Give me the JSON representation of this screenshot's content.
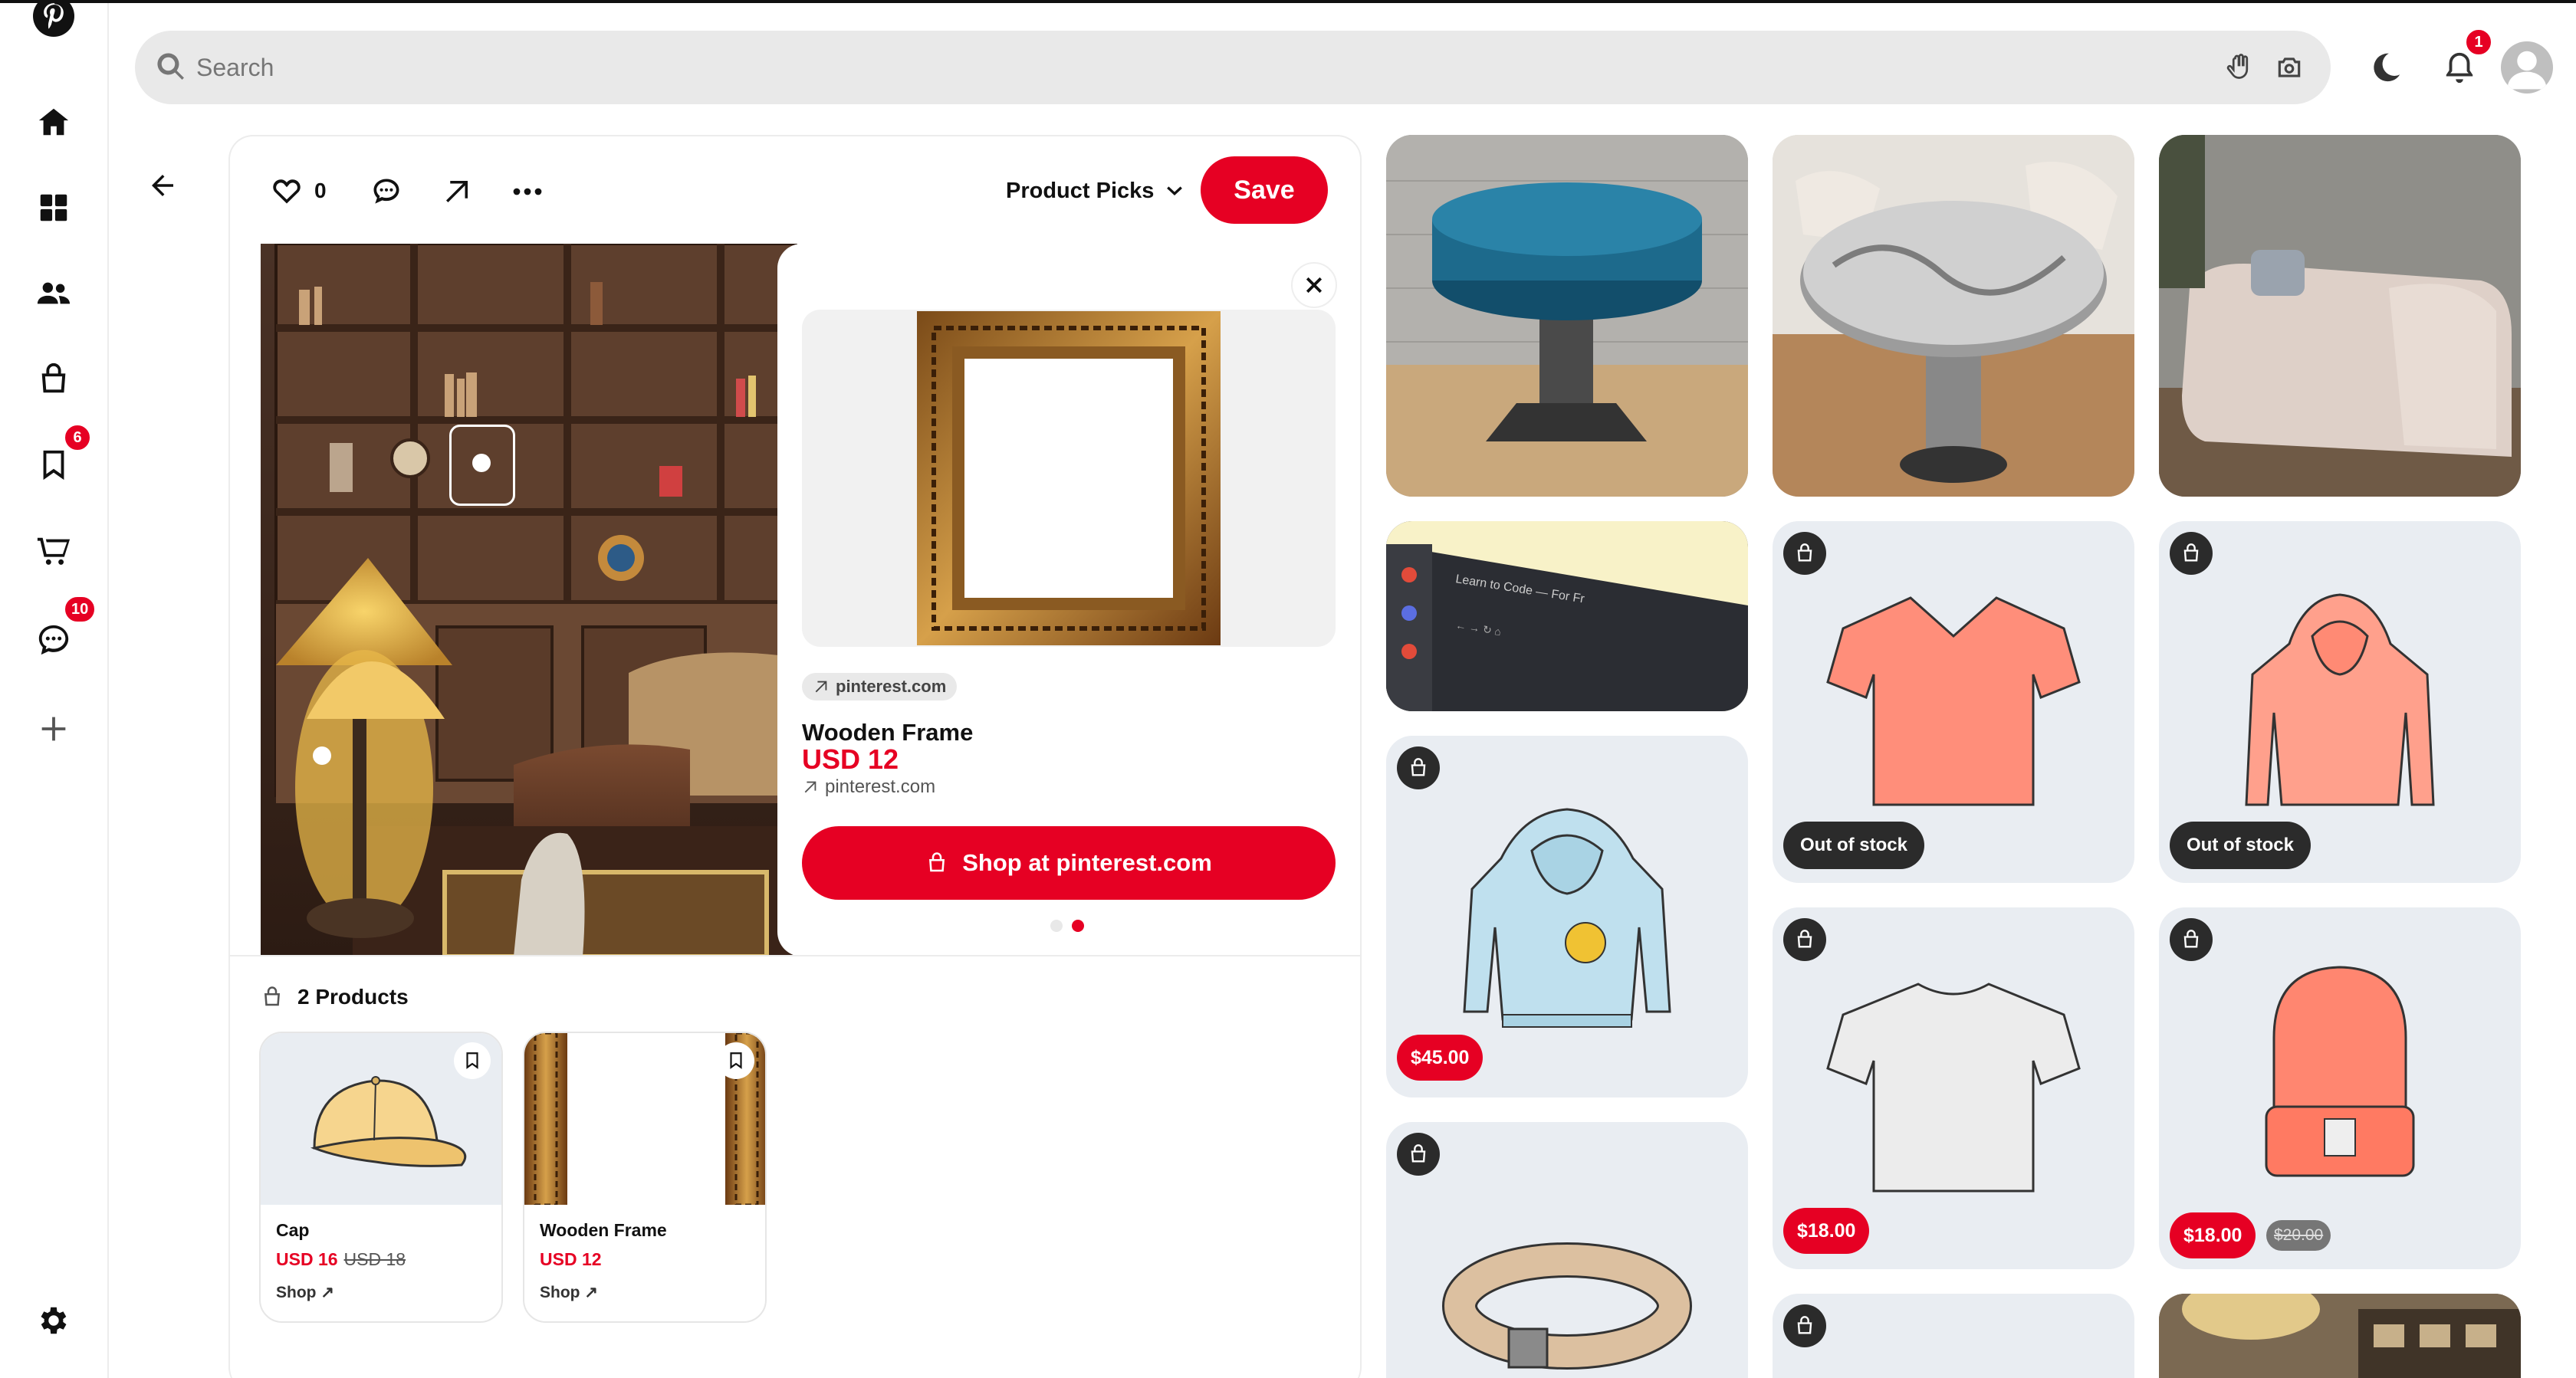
{
  "search": {
    "placeholder": "Search"
  },
  "sidebar": {
    "badges": {
      "saved": "6",
      "messages": "10"
    }
  },
  "header": {
    "notifications_badge": "1"
  },
  "pin": {
    "likes": "0",
    "board_name": "Product Picks",
    "save_label": "Save"
  },
  "product_popup": {
    "domain_chip": "pinterest.com",
    "name": "Wooden Frame",
    "price": "USD 12",
    "link": "pinterest.com",
    "shop_label": "Shop at pinterest.com"
  },
  "products": {
    "header": "2 Products",
    "items": [
      {
        "name": "Cap",
        "price": "USD 16",
        "old_price": "USD 18",
        "shop": "Shop"
      },
      {
        "name": "Wooden Frame",
        "price": "USD 12",
        "shop": "Shop"
      }
    ]
  },
  "grid": {
    "hoodie_price": "$45.00",
    "vneck_stock": "Out of stock",
    "hoodie2_stock": "Out of stock",
    "tee_price": "$18.00",
    "beanie_price": "$18.00",
    "beanie_old_price": "$20.00"
  },
  "colors": {
    "accent": "#e60023",
    "tile_bg": "#e9edf2"
  }
}
